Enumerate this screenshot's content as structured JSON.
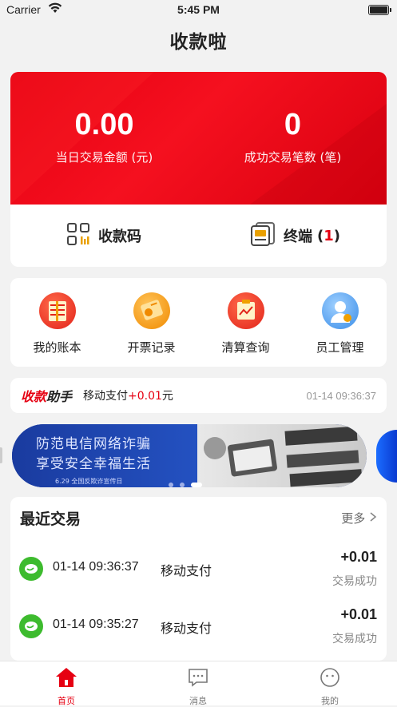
{
  "status_bar": {
    "carrier": "Carrier",
    "time": "5:45 PM"
  },
  "app_title": "收款啦",
  "summary": {
    "amount_value": "0.00",
    "amount_label": "当日交易金额 (元)",
    "count_value": "0",
    "count_label": "成功交易笔数 (笔)",
    "qr_label": "收款码",
    "terminal_label": "终端",
    "terminal_paren_open": "(",
    "terminal_count": "1",
    "terminal_paren_close": ")"
  },
  "menu": [
    {
      "label": "我的账本",
      "icon": "ledger-icon"
    },
    {
      "label": "开票记录",
      "icon": "invoice-icon"
    },
    {
      "label": "清算查询",
      "icon": "settlement-icon"
    },
    {
      "label": "员工管理",
      "icon": "staff-icon"
    }
  ],
  "ticker": {
    "logo_part1": "收款",
    "logo_part2": "助手",
    "message": "移动支付",
    "amount": "+0.01",
    "unit": "元",
    "time": "01-14 09:36:37"
  },
  "banner": {
    "line1": "防范电信网络诈骗",
    "line2": "享受安全幸福生活",
    "caption": "6.29 全国反欺诈宣传日"
  },
  "recent": {
    "heading": "最近交易",
    "more": "更多",
    "items": [
      {
        "time": "01-14 09:36:37",
        "method": "移动支付",
        "amount": "+0.01",
        "status": "交易成功"
      },
      {
        "time": "01-14 09:35:27",
        "method": "移动支付",
        "amount": "+0.01",
        "status": "交易成功"
      }
    ]
  },
  "tabbar": [
    {
      "label": "首页",
      "icon": "home-icon",
      "active": true
    },
    {
      "label": "消息",
      "icon": "message-icon",
      "active": false
    },
    {
      "label": "我的",
      "icon": "profile-icon",
      "active": false
    }
  ],
  "colors": {
    "brand_red": "#e60012",
    "wechat_green": "#3dbb2e"
  }
}
